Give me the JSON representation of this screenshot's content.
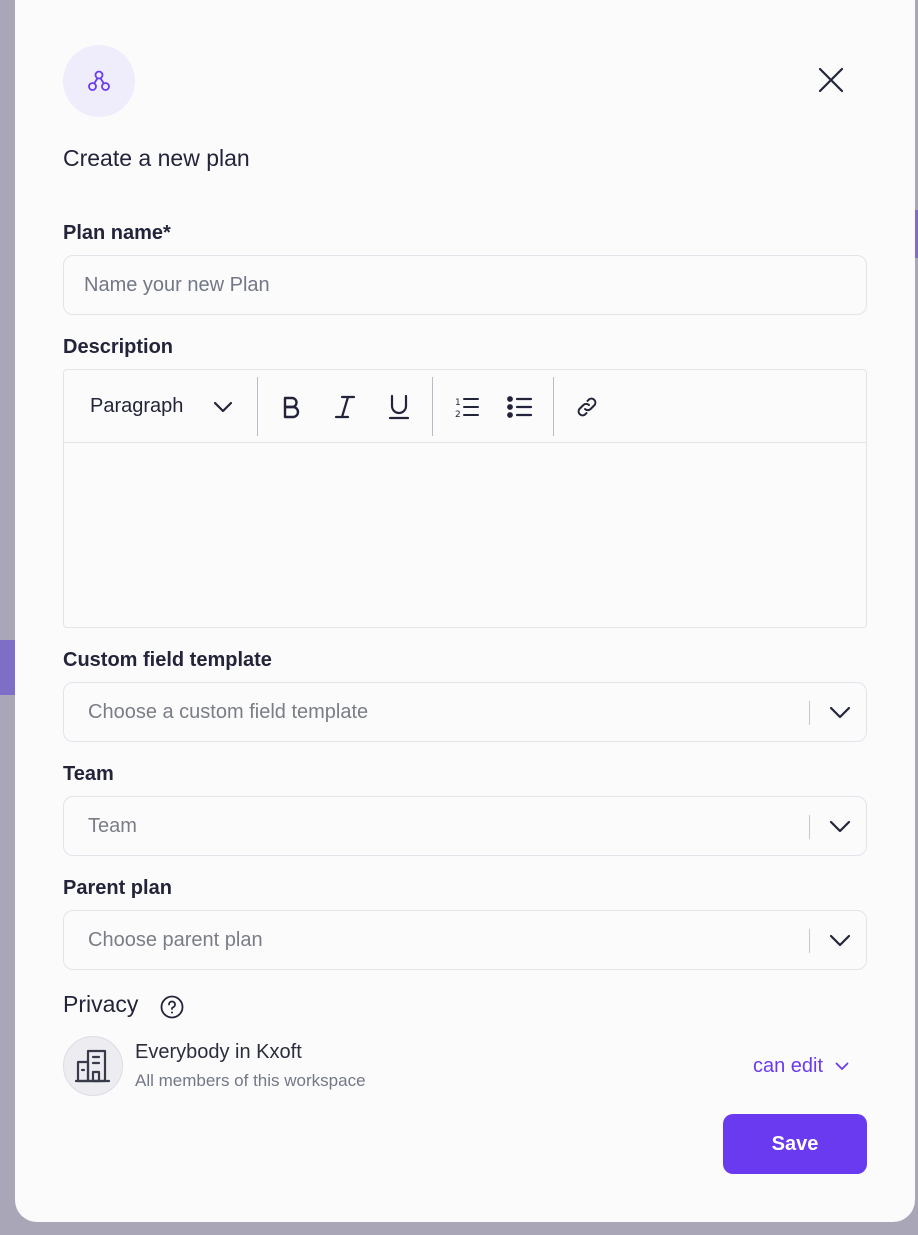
{
  "modal": {
    "title": "Create a new plan",
    "plan_icon": "nodes-icon",
    "close_icon": "close-icon"
  },
  "plan_name": {
    "label": "Plan name*",
    "placeholder": "Name your new Plan",
    "value": ""
  },
  "description": {
    "label": "Description",
    "toolbar": {
      "block_format": "Paragraph",
      "buttons": [
        "bold-icon",
        "italic-icon",
        "underline-icon",
        "ordered-list-icon",
        "bullet-list-icon",
        "link-icon"
      ]
    },
    "value": ""
  },
  "custom_field_template": {
    "label": "Custom field template",
    "placeholder": "Choose a custom field template"
  },
  "team": {
    "label": "Team",
    "placeholder": "Team"
  },
  "parent_plan": {
    "label": "Parent plan",
    "placeholder": "Choose parent plan"
  },
  "privacy": {
    "title": "Privacy",
    "member": {
      "name": "Everybody in Kxoft",
      "subtitle": "All members of this workspace",
      "permission": "can edit"
    }
  },
  "actions": {
    "save_label": "Save"
  },
  "colors": {
    "accent": "#6a3af0",
    "text": "#23243a",
    "muted": "#737786",
    "border": "#e3e4ea"
  }
}
